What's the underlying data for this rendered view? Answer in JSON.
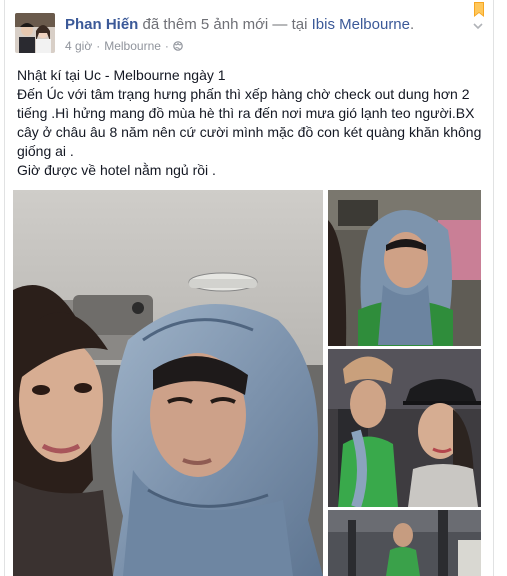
{
  "post": {
    "author_name": "Phan Hiến",
    "action_text": " đã thêm 5 ảnh mới — tại ",
    "location": "Ibis Melbourne",
    "location_suffix": ".",
    "time": "4 giờ",
    "separator": "·",
    "meta_location": "Melbourne",
    "privacy_icon": "globe-icon",
    "menu_icon": "chevron-down-icon",
    "bookmark_icon": "bookmark-icon",
    "lines": [
      "Nhật kí tại Uc - Melbourne ngày 1",
      "Đến Úc với tâm trạng hưng phấn thì xếp hàng chờ check out dung hơn 2 tiếng .Hì hửng mang đồ mùa hè thì ra đến nơi mưa gió lạnh teo người.BX cây ở châu âu 8 năm nên cứ cười mình mặc đồ con két quàng khăn không giống ai .",
      "Giờ được về hotel nằm ngủ rồi ."
    ]
  },
  "colors": {
    "link": "#3b5998",
    "meta": "#90949c",
    "text": "#141823"
  }
}
